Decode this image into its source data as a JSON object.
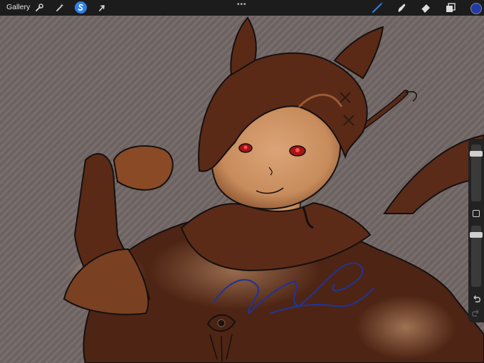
{
  "toolbar": {
    "gallery_label": "Gallery",
    "left_tools": [
      {
        "name": "actions",
        "icon": "wrench-icon"
      },
      {
        "name": "adjustments",
        "icon": "magic-wand-icon"
      },
      {
        "name": "selection",
        "icon": "selection-s-icon",
        "active": true
      },
      {
        "name": "transform",
        "icon": "arrow-cursor-icon"
      }
    ],
    "more_label": "•••",
    "right_tools": [
      {
        "name": "brush",
        "icon": "brush-icon",
        "active": true
      },
      {
        "name": "smudge",
        "icon": "smudge-finger-icon"
      },
      {
        "name": "eraser",
        "icon": "eraser-icon"
      },
      {
        "name": "layers",
        "icon": "layers-icon"
      }
    ],
    "current_color": "#213aa6"
  },
  "sidebar": {
    "brush_size_level": 0.12,
    "opacity_level": 0.12,
    "icons": [
      "modifier-square-icon",
      "undo-icon",
      "redo-icon"
    ]
  },
  "canvas": {
    "background": "#6f6564",
    "accent_colors": {
      "hair": "#5a2a16",
      "skin": "#d59a6a",
      "outline": "#151010",
      "eyes": "#c01818",
      "signature": "#22348f"
    }
  }
}
